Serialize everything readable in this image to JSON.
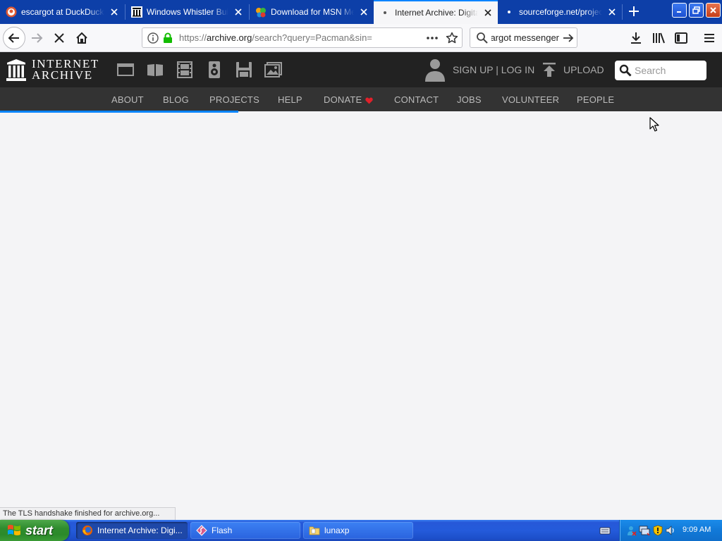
{
  "browser": {
    "tabs": [
      {
        "label": "escargot at DuckDuckGo",
        "favicon": "duckduckgo-icon"
      },
      {
        "label": "Windows Whistler Build",
        "favicon": "internet-archive-icon"
      },
      {
        "label": "Download for MSN Messenger",
        "favicon": "msn-butterfly-icon"
      },
      {
        "label": "Internet Archive: Digital Library",
        "favicon": "loading-dot-icon",
        "active": true
      },
      {
        "label": "sourceforge.net/projects",
        "favicon": "loading-dot-icon"
      }
    ],
    "url_prefix": "https://",
    "url_host": "archive.org",
    "url_rest": "/search?query=Pacman&sin=",
    "search_value": "escargot messenger",
    "accent": "#0a84ff",
    "tabbar_color": "#0d3fa8"
  },
  "ia": {
    "logo_line1": "INTERNET",
    "logo_line2": "ARCHIVE",
    "auth_text": "SIGN UP | LOG IN",
    "upload_label": "UPLOAD",
    "search_placeholder": "Search",
    "media_icons": [
      "web-icon",
      "texts-icon",
      "video-icon",
      "audio-icon",
      "software-icon",
      "images-icon"
    ],
    "nav": [
      "ABOUT",
      "BLOG",
      "PROJECTS",
      "HELP",
      "DONATE",
      "CONTACT",
      "JOBS",
      "VOLUNTEER",
      "PEOPLE"
    ],
    "donate_heart_color": "#e0202a"
  },
  "page_load_progress": 0.33,
  "status_text": "The TLS handshake finished for archive.org...",
  "taskbar": {
    "start_label": "start",
    "tasks": [
      {
        "label": "Internet Archive: Digi...",
        "icon": "firefox-icon",
        "active": true
      },
      {
        "label": "Flash",
        "icon": "flash-icon",
        "active": false
      },
      {
        "label": "lunaxp",
        "icon": "folder-icon",
        "active": false
      }
    ],
    "clock": "9:09 AM"
  }
}
